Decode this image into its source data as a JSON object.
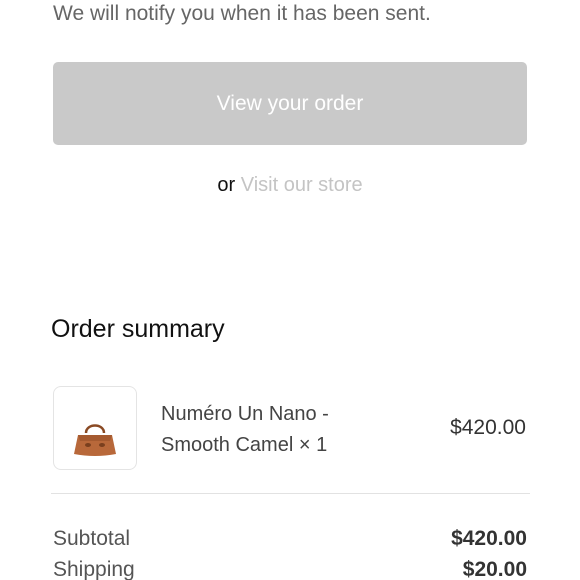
{
  "confirmation": {
    "notify_text": "We will notify you when it has been sent.",
    "view_order_label": "View your order",
    "or_text": "or",
    "visit_store_label": "Visit our store"
  },
  "order_summary": {
    "title": "Order summary",
    "items": [
      {
        "name": "Numéro Un Nano - Smooth Camel × 1",
        "price": "$420.00",
        "thumbnail_icon": "camel-handbag-image"
      }
    ],
    "subtotal_label": "Subtotal",
    "subtotal_value": "$420.00",
    "shipping_label": "Shipping",
    "shipping_value": "$20.00"
  },
  "colors": {
    "button_disabled": "#c9c9c9",
    "link_muted": "#c4c4c4",
    "bag_camel": "#b8683a"
  }
}
